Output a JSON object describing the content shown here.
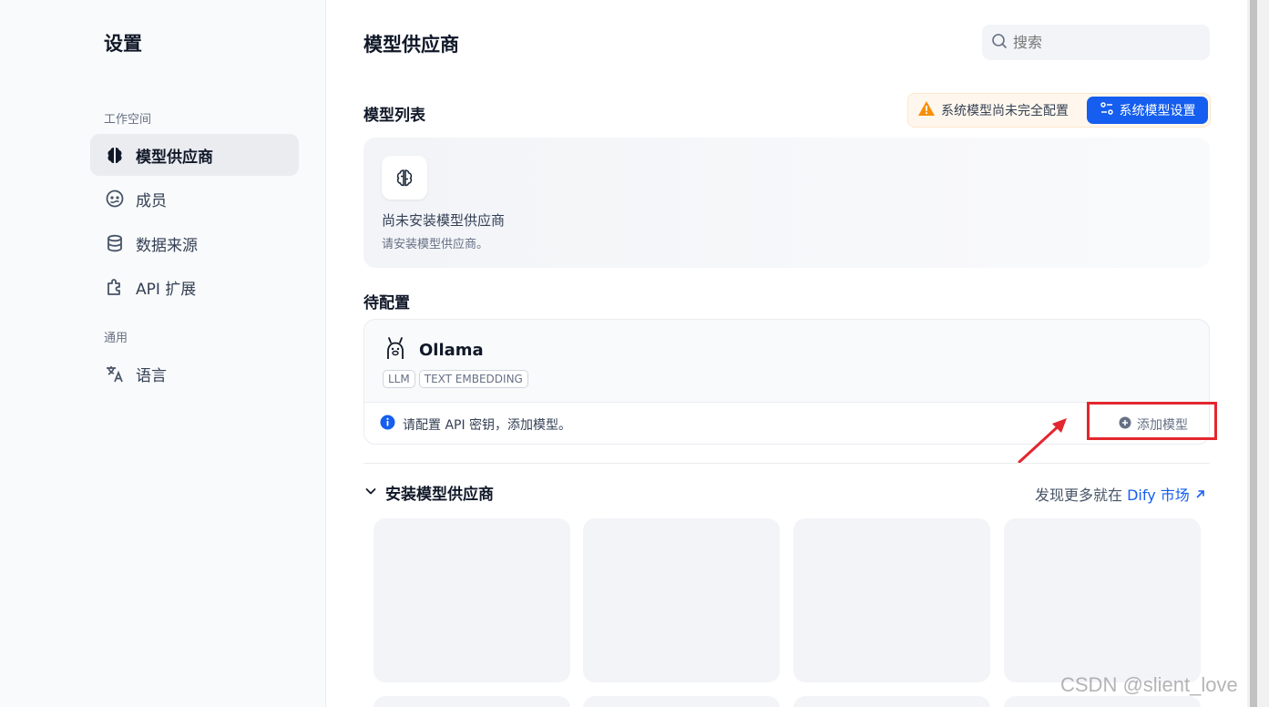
{
  "sidebar": {
    "title": "设置",
    "workspace_label": "工作空间",
    "general_label": "通用",
    "items": [
      {
        "label": "模型供应商",
        "icon": "brain-icon"
      },
      {
        "label": "成员",
        "icon": "members-icon"
      },
      {
        "label": "数据来源",
        "icon": "database-icon"
      },
      {
        "label": "API 扩展",
        "icon": "puzzle-icon"
      },
      {
        "label": "语言",
        "icon": "translate-icon"
      }
    ]
  },
  "header": {
    "title": "模型供应商",
    "search_placeholder": "搜索"
  },
  "model_list": {
    "title": "模型列表",
    "warning_text": "系统模型尚未完全配置",
    "system_settings_button": "系统模型设置",
    "empty_title": "尚未安装模型供应商",
    "empty_subtitle": "请安装模型供应商。"
  },
  "pending": {
    "title": "待配置",
    "provider_name": "Ollama",
    "tags": [
      "LLM",
      "TEXT EMBEDDING"
    ],
    "hint": "请配置 API 密钥，添加模型。",
    "add_model_button": "添加模型"
  },
  "install": {
    "title": "安装模型供应商",
    "market_prefix": "发现更多就在",
    "market_link": "Dify 市场"
  },
  "watermark": "CSDN @slient_love",
  "colors": {
    "accent": "#155eef",
    "warning": "#f79009",
    "highlight_box": "#e3262f"
  }
}
